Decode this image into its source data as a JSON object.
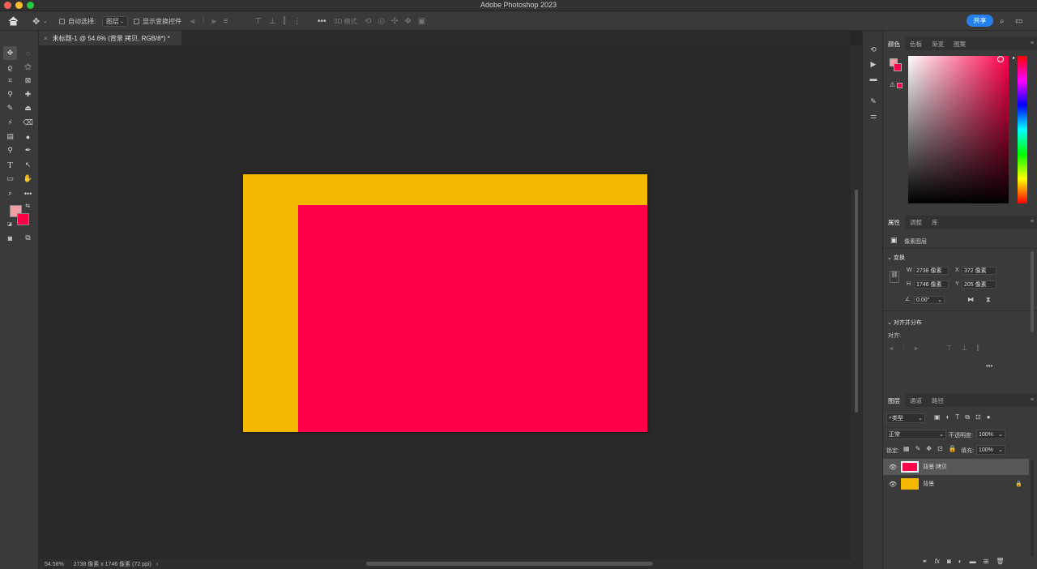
{
  "app": {
    "title": "Adobe Photoshop 2023"
  },
  "options_bar": {
    "auto_select_label": "自动选择:",
    "auto_select_value": "图层",
    "show_transform_label": "显示变换控件",
    "mode_3d_label": "3D 模式:",
    "share_label": "共享"
  },
  "document": {
    "tab_title": "未标题-1 @ 54.6% (背景 拷贝, RGB/8*) *",
    "zoom": "54.58%",
    "info": "2738 像素 x 1746 像素 (72 ppi)",
    "background_color": "#f5b800",
    "layer_color": "#ff0048"
  },
  "colors": {
    "foreground": "#f29ca3",
    "background": "#ff0048",
    "accent": "#2680eb"
  },
  "color_panel": {
    "tabs": [
      "颜色",
      "色板",
      "渐变",
      "图案"
    ],
    "active": 0
  },
  "properties_panel": {
    "tabs": [
      "属性",
      "调整",
      "库"
    ],
    "layer_type": "像素图层",
    "transform_title": "变换",
    "w_label": "W",
    "w": "2738 像素",
    "x_label": "X",
    "x": "372 像素",
    "h_label": "H",
    "h": "1746 像素",
    "y_label": "Y",
    "y": "205 像素",
    "angle": "0.00°",
    "align_title": "对齐并分布",
    "align_label": "对齐:",
    "more": "•••"
  },
  "layers_panel": {
    "tabs": [
      "图层",
      "通道",
      "路径"
    ],
    "filter_label": "类型",
    "blend_mode": "正常",
    "opacity_label": "不透明度:",
    "opacity": "100%",
    "lock_label": "锁定:",
    "fill_label": "填充:",
    "fill": "100%",
    "layers": [
      {
        "name": "背景 拷贝",
        "color": "#ff0048",
        "selected": true,
        "locked": false
      },
      {
        "name": "背景",
        "color": "#f5b800",
        "selected": false,
        "locked": true
      }
    ]
  }
}
